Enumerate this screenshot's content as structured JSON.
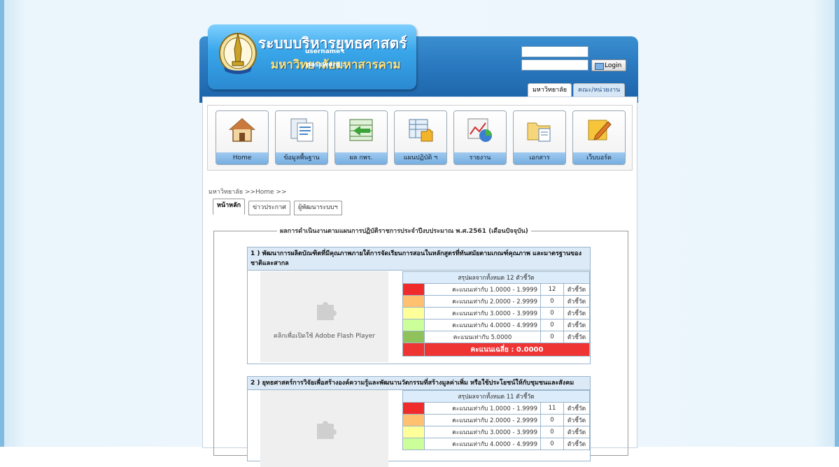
{
  "header": {
    "title_line1": "ระบบบริหารยุทธศาสตร์",
    "title_line2": "มหาวิทยาลัยมหาสารคาม",
    "username_label": "username :",
    "password_label": "password :",
    "username_value": "",
    "password_value": "",
    "login_label": "Login",
    "tabs": [
      {
        "label": "มหาวิทยาลัย"
      },
      {
        "label": "คณะ/หน่วยงาน"
      }
    ]
  },
  "menu": [
    {
      "label": "Home",
      "icon": "home-icon"
    },
    {
      "label": "ข้อมูลพื้นฐาน",
      "icon": "document-icon"
    },
    {
      "label": "ผล กพร.",
      "icon": "spreadsheet-arrow-icon"
    },
    {
      "label": "แผนปฏิบัติ ฯ",
      "icon": "table-puzzle-icon"
    },
    {
      "label": "รายงาน",
      "icon": "chart-icon"
    },
    {
      "label": "เอกสาร",
      "icon": "folder-icon"
    },
    {
      "label": "เว็บบอร์ด",
      "icon": "notepad-pencil-icon"
    }
  ],
  "breadcrumb": "มหาวิทยาลัย >>Home >>",
  "content_tabs": [
    {
      "label": "หน้าหลัก"
    },
    {
      "label": "ข่าวประกาศ"
    },
    {
      "label": "ผู้พัฒนาระบบฯ"
    }
  ],
  "section_title": "ผลการดำเนินงานตามแผนการปฏิบัติราชการประจำปีงบประมาณ พ.ศ.2561 (เดือนปัจจุบัน)",
  "flash_text": "คลิกเพื่อเปิดใช้ Adobe Flash Player",
  "colors": {
    "r1": "#ef2b2b",
    "r2": "#ffc170",
    "r3": "#ffff99",
    "r4": "#ccff99",
    "r5": "#8fc25a"
  },
  "cards": [
    {
      "title": "1 ) พัฒนาการผลิตบัณฑิตที่มีคุณภาพภายใต้การจัดเรียนการสอนในหลักสูตรที่ทันสมัยตามเกณฑ์คุณภาพ และมาตรฐานของชาติและสากล",
      "summary": "สรุปผลจากทั้งหมด 12 ตัวชี้วัด",
      "rows": [
        {
          "range": "คะแนนเท่ากับ 1.0000 - 1.9999",
          "count": "12",
          "unit": "ตัวชี้วัด"
        },
        {
          "range": "คะแนนเท่ากับ 2.0000 - 2.9999",
          "count": "0",
          "unit": "ตัวชี้วัด"
        },
        {
          "range": "คะแนนเท่ากับ 3.0000 - 3.9999",
          "count": "0",
          "unit": "ตัวชี้วัด"
        },
        {
          "range": "คะแนนเท่ากับ 4.0000 - 4.9999",
          "count": "0",
          "unit": "ตัวชี้วัด"
        },
        {
          "range": "คะแนนเท่ากับ 5.0000",
          "count": "0",
          "unit": "ตัวชี้วัด"
        }
      ],
      "average": "คะแนนเฉลี่ย : 0.0000"
    },
    {
      "title": "2 ) ยุทธศาสตร์การวิจัยเพื่อสร้างองค์ความรู้และพัฒนานวัตกรรมที่สร้างมูลค่าเพิ่ม หรือใช้ประโยชน์ให้กับชุมชนและสังคม",
      "summary": "สรุปผลจากทั้งหมด 11 ตัวชี้วัด",
      "rows": [
        {
          "range": "คะแนนเท่ากับ 1.0000 - 1.9999",
          "count": "11",
          "unit": "ตัวชี้วัด"
        },
        {
          "range": "คะแนนเท่ากับ 2.0000 - 2.9999",
          "count": "0",
          "unit": "ตัวชี้วัด"
        },
        {
          "range": "คะแนนเท่ากับ 3.0000 - 3.9999",
          "count": "0",
          "unit": "ตัวชี้วัด"
        },
        {
          "range": "คะแนนเท่ากับ 4.0000 - 4.9999",
          "count": "0",
          "unit": "ตัวชี้วัด"
        }
      ]
    }
  ]
}
